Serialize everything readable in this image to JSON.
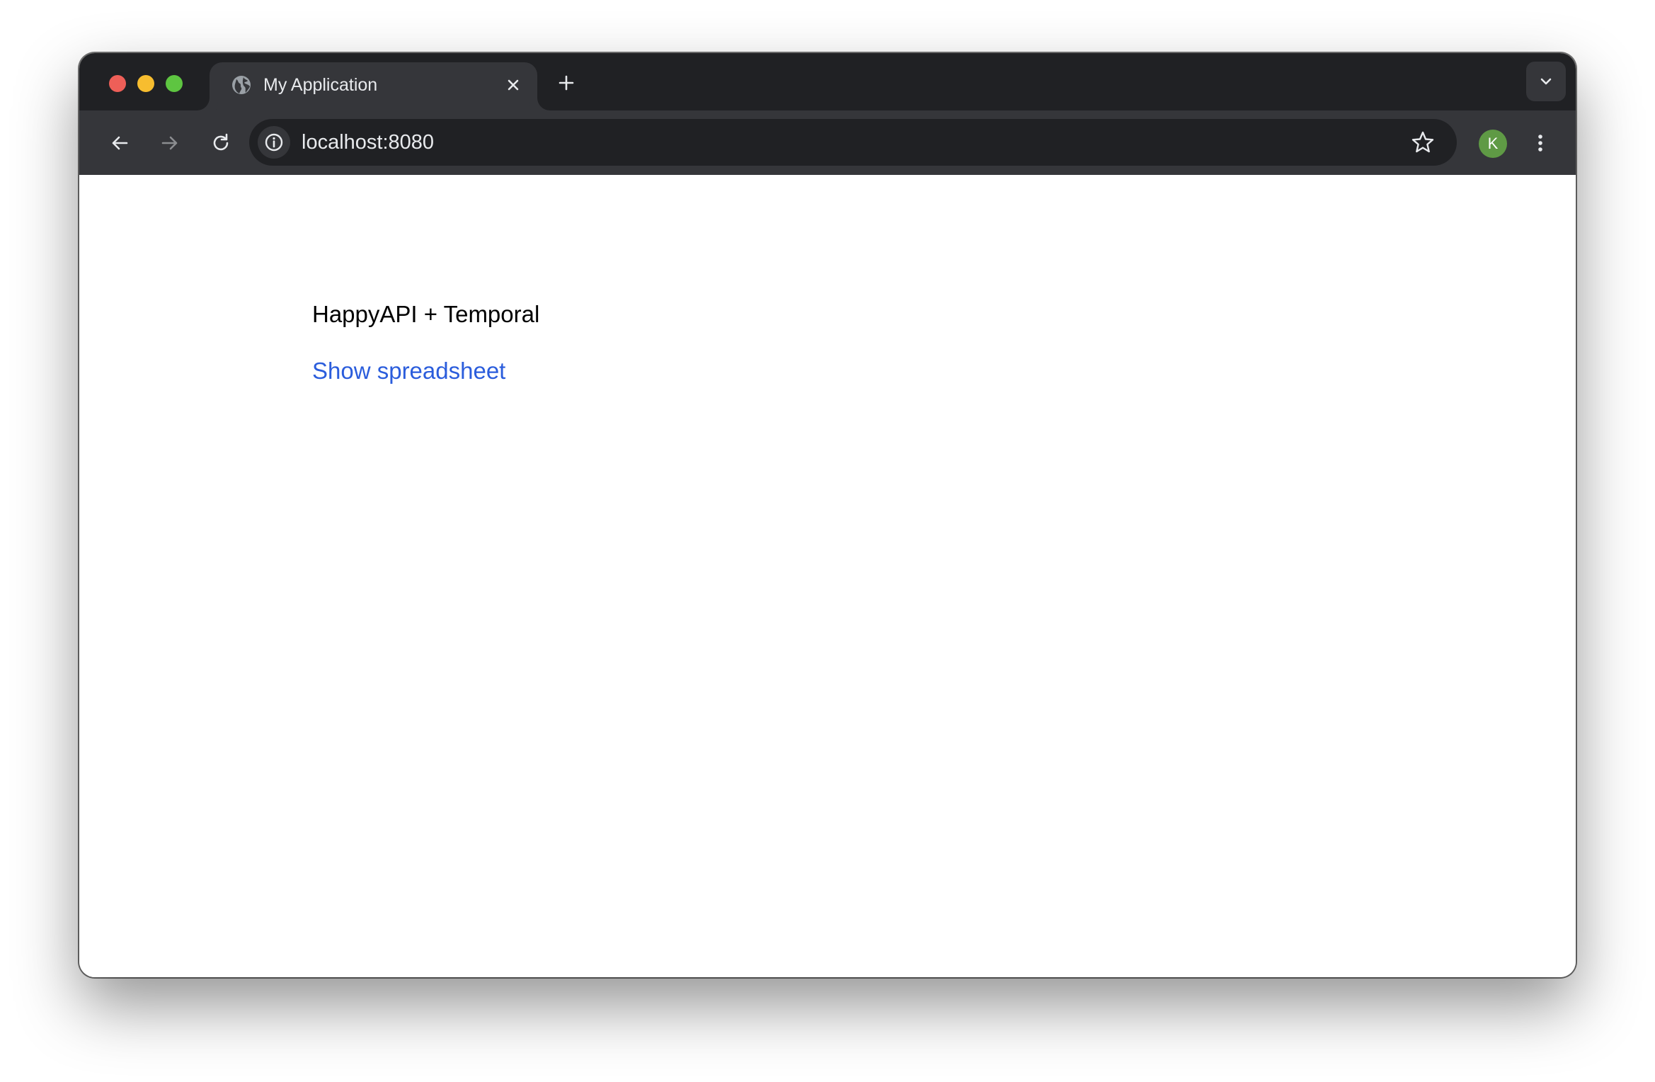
{
  "browser": {
    "tab": {
      "title": "My Application",
      "favicon": "globe-icon",
      "close_icon": "close-icon"
    },
    "new_tab_icon": "plus-icon",
    "tab_search_icon": "chevron-down-icon",
    "toolbar": {
      "back_icon": "arrow-left-icon",
      "forward_icon": "arrow-right-icon",
      "reload_icon": "reload-icon",
      "site_info_icon": "info-icon",
      "url": "localhost:8080",
      "bookmark_icon": "star-icon",
      "profile_initial": "K",
      "profile_color": "#5f9a45",
      "menu_icon": "kebab-menu-icon"
    },
    "colors": {
      "tabstrip": "#202124",
      "toolbar": "#35363a",
      "close_red": "#ee5f58",
      "minimize_yellow": "#f7bd2f",
      "maximize_green": "#5ec541"
    }
  },
  "page": {
    "title": "HappyAPI + Temporal",
    "link_label": "Show spreadsheet",
    "link_color": "#2b5ddc"
  }
}
